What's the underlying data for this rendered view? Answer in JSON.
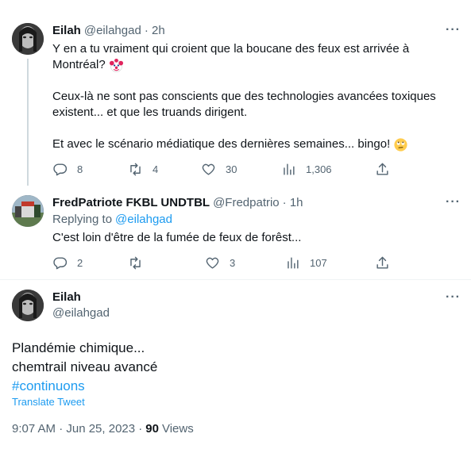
{
  "tweet1": {
    "display_name": "Eilah",
    "handle": "@eilahgad",
    "time": "· 2h",
    "line1": "Y en a tu vraiment qui croient que la boucane des feux est arrivée à",
    "line2": "Montréal?",
    "line3": "Ceux-là ne sont pas conscients que des technologies avancées toxiques",
    "line4": "existent... et que les truands dirigent.",
    "line5": "Et avec le scénario médiatique des dernières semaines... bingo!",
    "replies": "8",
    "retweets": "4",
    "likes": "30",
    "views": "1,306"
  },
  "tweet2": {
    "display_name": "FredPatriote FKBL UNDTBL",
    "handle": "@Fredpatrio",
    "time": "· 1h",
    "replying_prefix": "Replying to",
    "replying_handle": "@eilahgad",
    "text": "C'est loin d'être de la fumée de feux de forêst...",
    "replies": "2",
    "retweets": "",
    "likes": "3",
    "views": "107"
  },
  "main_tweet": {
    "display_name": "Eilah",
    "handle": "@eilahgad",
    "line1": "Plandémie chimique...",
    "line2": "chemtrail niveau avancé",
    "hashtag": "#continuons",
    "translate": "Translate Tweet",
    "timestamp": "9:07 AM · Jun 25, 2023 ·",
    "views_count": "90",
    "views_label": "Views"
  },
  "more_icon": "···",
  "colors": {
    "accent": "#1d9bf0",
    "muted": "#536471",
    "text": "#0f1419",
    "line": "#cfd9de"
  },
  "icons": [
    "reply-icon",
    "retweet-icon",
    "like-icon",
    "views-icon",
    "share-icon",
    "more-icon",
    "clown-emoji-icon",
    "eyeroll-emoji-icon"
  ]
}
